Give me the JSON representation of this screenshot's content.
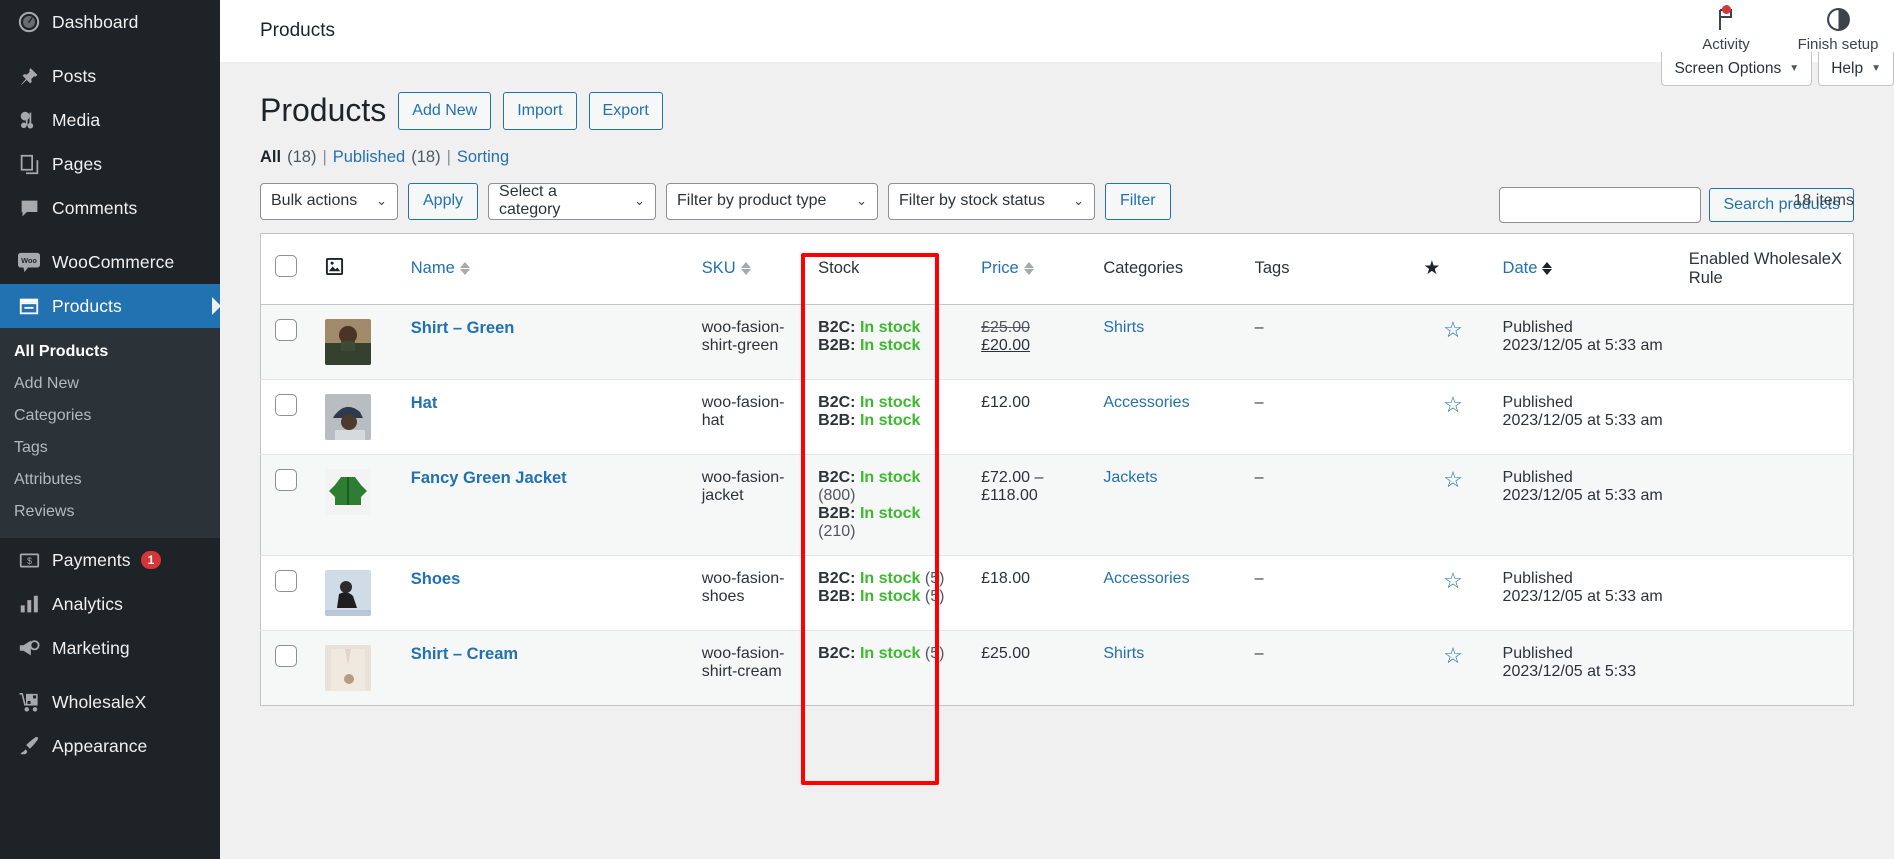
{
  "sidebar": {
    "items": [
      {
        "label": "Dashboard",
        "icon": "dashboard-icon",
        "name": "dashboard"
      },
      {
        "label": "Posts",
        "icon": "pin-icon",
        "name": "posts"
      },
      {
        "label": "Media",
        "icon": "media-icon",
        "name": "media"
      },
      {
        "label": "Pages",
        "icon": "pages-icon",
        "name": "pages"
      },
      {
        "label": "Comments",
        "icon": "comments-icon",
        "name": "comments"
      },
      {
        "label": "WooCommerce",
        "icon": "woo-icon",
        "name": "woocommerce"
      },
      {
        "label": "Products",
        "icon": "products-icon",
        "name": "products",
        "current": true
      }
    ],
    "submenu": [
      {
        "label": "All Products",
        "active": true
      },
      {
        "label": "Add New",
        "active": false
      },
      {
        "label": "Categories",
        "active": false
      },
      {
        "label": "Tags",
        "active": false
      },
      {
        "label": "Attributes",
        "active": false
      },
      {
        "label": "Reviews",
        "active": false
      }
    ],
    "items_after": [
      {
        "label": "Payments",
        "icon": "payments-icon",
        "name": "payments",
        "badge": "1"
      },
      {
        "label": "Analytics",
        "icon": "analytics-icon",
        "name": "analytics"
      },
      {
        "label": "Marketing",
        "icon": "marketing-icon",
        "name": "marketing"
      },
      {
        "label": "WholesaleX",
        "icon": "wholesalex-icon",
        "name": "wholesalex"
      },
      {
        "label": "Appearance",
        "icon": "appearance-icon",
        "name": "appearance"
      }
    ]
  },
  "adminbar": {
    "title": "Products",
    "activity_label": "Activity",
    "finish_setup_label": "Finish setup"
  },
  "screen_meta": {
    "screen_options": "Screen Options",
    "help": "Help",
    "caret": "▼"
  },
  "header": {
    "page_title": "Products",
    "add_new": "Add New",
    "import": "Import",
    "export": "Export"
  },
  "views": {
    "all_label": "All",
    "all_count": "(18)",
    "published_label": "Published",
    "published_count": "(18)",
    "sorting_label": "Sorting",
    "separator": "|"
  },
  "search": {
    "value": "",
    "placeholder": "",
    "button_label": "Search products"
  },
  "filters": {
    "bulk_actions": "Bulk actions",
    "apply": "Apply",
    "select_category": "Select a category",
    "filter_product_type": "Filter by product type",
    "filter_stock_status": "Filter by stock status",
    "filter": "Filter",
    "items_count": "18 items",
    "chevron": "⌄"
  },
  "table": {
    "columns": {
      "name": "Name",
      "sku": "SKU",
      "stock": "Stock",
      "price": "Price",
      "categories": "Categories",
      "tags": "Tags",
      "featured": "★",
      "date": "Date",
      "wholesalex": "Enabled WholesaleX Rule"
    },
    "rows": [
      {
        "name": "Shirt – Green",
        "sku": "woo-fasion-shirt-green",
        "stock": [
          {
            "label": "B2C:",
            "status": "In stock",
            "qty": ""
          },
          {
            "label": "B2B:",
            "status": "In stock",
            "qty": ""
          }
        ],
        "price_old": "£25.00",
        "price_new": "£20.00",
        "price": "",
        "category": "Shirts",
        "tags": "–",
        "featured": "☆",
        "date_status": "Published",
        "date_when": "2023/12/05 at 5:33 am",
        "wholesalex": "",
        "thumb_color": "#8a7a63"
      },
      {
        "name": "Hat",
        "sku": "woo-fasion-hat",
        "stock": [
          {
            "label": "B2C:",
            "status": "In stock",
            "qty": ""
          },
          {
            "label": "B2B:",
            "status": "In stock",
            "qty": ""
          }
        ],
        "price_old": "",
        "price_new": "",
        "price": "£12.00",
        "category": "Accessories",
        "tags": "–",
        "featured": "☆",
        "date_status": "Published",
        "date_when": "2023/12/05 at 5:33 am",
        "wholesalex": "",
        "thumb_color": "#3a4350"
      },
      {
        "name": "Fancy Green Jacket",
        "sku": "woo-fasion-jacket",
        "stock": [
          {
            "label": "B2C:",
            "status": "In stock",
            "qty": "(800)"
          },
          {
            "label": "B2B:",
            "status": "In stock",
            "qty": "(210)"
          }
        ],
        "price_old": "",
        "price_new": "",
        "price": "£72.00 – £118.00",
        "category": "Jackets",
        "tags": "–",
        "featured": "☆",
        "date_status": "Published",
        "date_when": "2023/12/05 at 5:33 am",
        "wholesalex": "",
        "thumb_color": "#2e7d32"
      },
      {
        "name": "Shoes",
        "sku": "woo-fasion-shoes",
        "stock": [
          {
            "label": "B2C:",
            "status": "In stock",
            "qty": "(5)"
          },
          {
            "label": "B2B:",
            "status": "In stock",
            "qty": "(5)"
          }
        ],
        "price_old": "",
        "price_new": "",
        "price": "£18.00",
        "category": "Accessories",
        "tags": "–",
        "featured": "☆",
        "date_status": "Published",
        "date_when": "2023/12/05 at 5:33 am",
        "wholesalex": "",
        "thumb_color": "#ccd8e4"
      },
      {
        "name": "Shirt – Cream",
        "sku": "woo-fasion-shirt-cream",
        "stock": [
          {
            "label": "B2C:",
            "status": "In stock",
            "qty": "(5)"
          }
        ],
        "price_old": "",
        "price_new": "",
        "price": "£25.00",
        "category": "Shirts",
        "tags": "–",
        "featured": "☆",
        "date_status": "Published",
        "date_when": "2023/12/05 at 5:33",
        "wholesalex": "",
        "thumb_color": "#d8cfc4"
      }
    ]
  },
  "highlight": {
    "color": "#ff0000",
    "target_column": "Stock"
  }
}
